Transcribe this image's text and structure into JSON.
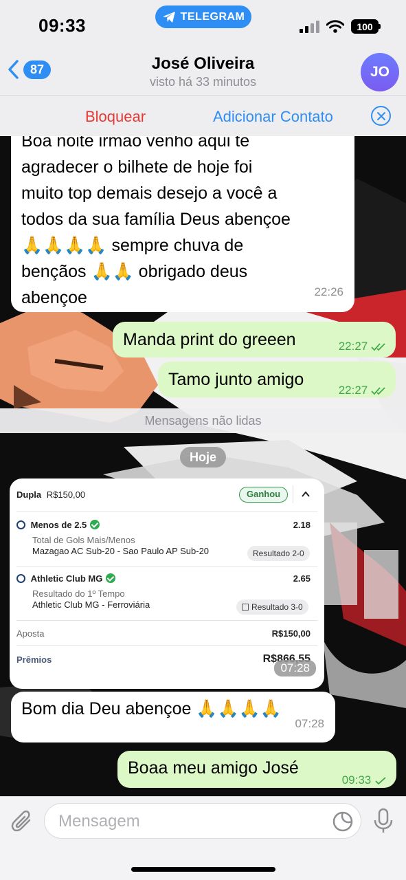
{
  "status_bar": {
    "time": "09:33",
    "app_pill": "TELEGRAM",
    "battery": "100"
  },
  "header": {
    "back_count": "87",
    "contact_name": "José Oliveira",
    "contact_status": "visto há 33 minutos",
    "avatar_initials": "JO",
    "block_label": "Bloquear",
    "add_contact_label": "Adicionar Contato"
  },
  "messages": [
    {
      "from": "contact",
      "text_lines": [
        "Boa noite irmão venho aqui te",
        "agradecer o bilhete de hoje foi",
        "muito top demais desejo a você a",
        "todos da sua família Deus abençoe",
        "🙏🙏🙏🙏 sempre chuva de",
        "bençãos 🙏🙏 obrigado deus",
        "abençoe"
      ],
      "time": "22:26"
    },
    {
      "from": "me",
      "text": "Manda print do greeen",
      "time": "22:27",
      "status": "read"
    },
    {
      "from": "me",
      "text": "Tamo junto amigo",
      "time": "22:27",
      "status": "read"
    }
  ],
  "unread_label": "Mensagens não lidas",
  "day_label": "Hoje",
  "bet_card": {
    "type_label": "Dupla",
    "stake_header": "R$150,00",
    "result_badge": "Ganhou",
    "selections": [
      {
        "pick": "Menos de 2.5",
        "odd": "2.18",
        "market": "Total de Gols Mais/Menos",
        "match": "Mazagao AC Sub-20 - Sao Paulo AP Sub-20",
        "result": "Resultado 2-0"
      },
      {
        "pick": "Athletic Club MG",
        "odd": "2.65",
        "market": "Resultado do 1º Tempo",
        "match": "Athletic Club MG - Ferroviária",
        "result": "Resultado 3-0"
      }
    ],
    "stake_label": "Aposta",
    "stake_value": "R$150,00",
    "prize_label": "Prêmios",
    "prize_value": "R$866,55",
    "time": "07:28"
  },
  "messages_today": [
    {
      "from": "contact",
      "text": "Bom dia Deu abençoe 🙏🙏🙏🙏",
      "time": "07:28"
    },
    {
      "from": "me",
      "text": "Boaa meu amigo José",
      "time": "09:33",
      "status": "sent"
    }
  ],
  "composer": {
    "placeholder": "Mensagem"
  },
  "colors": {
    "accent": "#2f8ef3",
    "outgoing_bubble": "#dcf8c6",
    "danger": "#e53935",
    "read_check": "#3fa84a"
  }
}
